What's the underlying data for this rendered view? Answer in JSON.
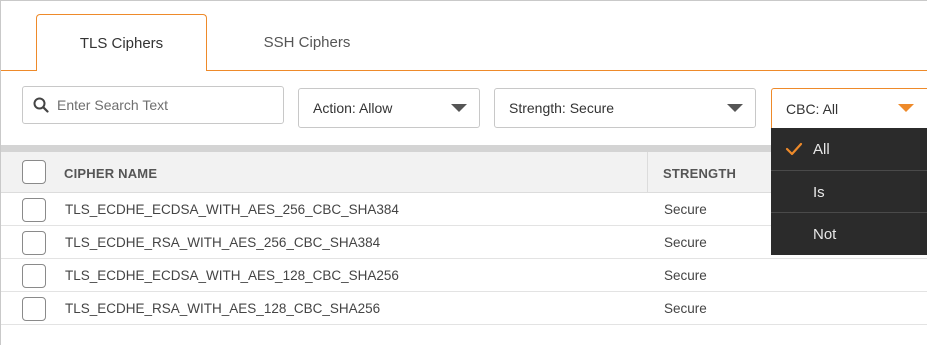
{
  "tabs": [
    {
      "label": "TLS Ciphers",
      "active": true
    },
    {
      "label": "SSH Ciphers",
      "active": false
    }
  ],
  "search": {
    "placeholder": "Enter Search Text",
    "value": ""
  },
  "filters": {
    "action": {
      "key": "Action:",
      "value": "Allow"
    },
    "strength": {
      "key": "Strength:",
      "value": "Secure"
    },
    "cbc": {
      "key": "CBC:",
      "value": "All",
      "open": true
    }
  },
  "cbc_dropdown": {
    "options": [
      "All",
      "Is",
      "Not"
    ],
    "selected": "All"
  },
  "table": {
    "columns": [
      "CIPHER NAME",
      "STRENGTH"
    ],
    "rows": [
      {
        "name": "TLS_ECDHE_ECDSA_WITH_AES_256_CBC_SHA384",
        "strength": "Secure",
        "checked": false
      },
      {
        "name": "TLS_ECDHE_RSA_WITH_AES_256_CBC_SHA384",
        "strength": "Secure",
        "checked": false
      },
      {
        "name": "TLS_ECDHE_ECDSA_WITH_AES_128_CBC_SHA256",
        "strength": "Secure",
        "checked": false
      },
      {
        "name": "TLS_ECDHE_RSA_WITH_AES_128_CBC_SHA256",
        "strength": "Secure",
        "checked": false
      }
    ]
  },
  "colors": {
    "accent": "#ee8a2a",
    "dropdown_bg": "#2b2b2b",
    "header_bg": "#f2f2f2"
  },
  "icons": {
    "search": "search-icon",
    "caret": "caret-down-icon",
    "check": "checkmark-icon"
  }
}
